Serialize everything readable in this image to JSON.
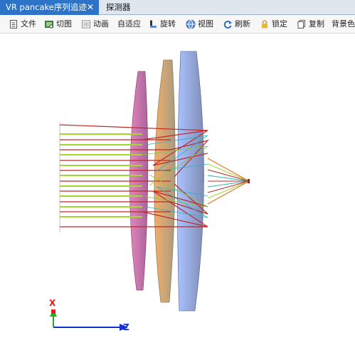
{
  "tabs": [
    {
      "label": "VR pancake序列追迹",
      "active": true,
      "close": "✕"
    },
    {
      "label": "探测器",
      "active": false
    }
  ],
  "toolbar": {
    "items": [
      {
        "label": "文件",
        "icon": "document-icon"
      },
      {
        "label": "切图",
        "icon": "crop-icon"
      },
      {
        "label": "动画",
        "icon": "animation-icon"
      },
      {
        "label": "自适应",
        "icon": "none"
      },
      {
        "label": "旋转",
        "icon": "rotate-icon"
      },
      {
        "label": "视图",
        "icon": "globe-icon"
      },
      {
        "label": "刷新",
        "icon": "refresh-icon"
      },
      {
        "label": "锁定",
        "icon": "lock-icon"
      },
      {
        "label": "复制",
        "icon": "copy-icon"
      },
      {
        "label": "背景色",
        "icon": "none"
      }
    ]
  },
  "axes": {
    "x_label": "X",
    "z_label": "Z",
    "colors": {
      "x": "#e02020",
      "y": "#20b020",
      "z": "#1030d0"
    }
  },
  "scene": {
    "lens_colors": [
      "#c05aa0",
      "#e0a060",
      "#8aa6e8"
    ],
    "ray_colors": [
      "#a0d830",
      "#c02828",
      "#30b0b0"
    ]
  }
}
